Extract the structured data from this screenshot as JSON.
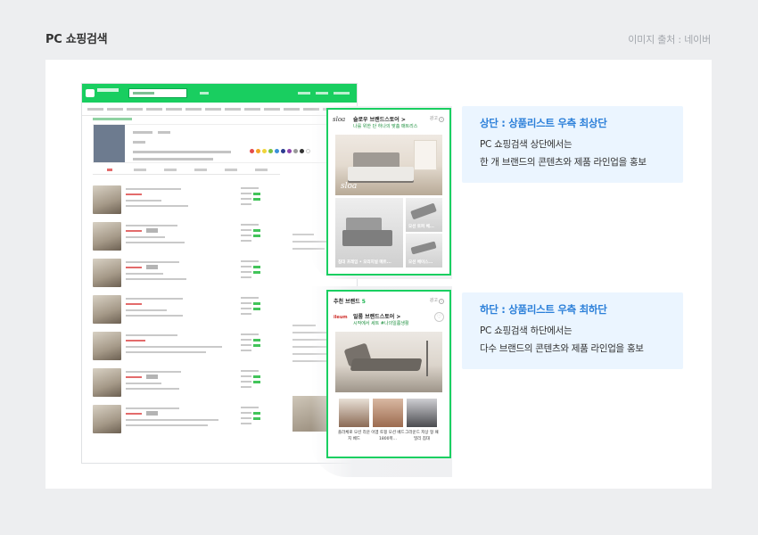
{
  "header": {
    "title": "PC 쇼핑검색",
    "source": "이미지 출처 : 네이버"
  },
  "callout_top": {
    "logo": "sloa",
    "brand_name": "슬로우 브랜드스토어 >",
    "brand_sub": "나를 위한 단 하나의 맞춤 매트리스",
    "ad_label": "광고",
    "info_icon": "i",
    "hero_mark": "sloa",
    "tiles": [
      "침대 프레임 • 오리지널 매트...",
      "모션 토퍼 베...",
      "모션 베이스..."
    ]
  },
  "callout_bottom": {
    "title": "추천 브랜드",
    "count": "5",
    "ad_label": "광고",
    "info_icon": "i",
    "logo": "ileum",
    "brand_name": "일룸 브랜드스토어 >",
    "brand_sub": "시작에서 세트 #나의일룸생활",
    "products": [
      "플라체로 모션 라운지 베드",
      "이엠 토핑 모션 베드 1800폭...",
      "그라운드 저상 형 패밀리 침대"
    ]
  },
  "info_top": {
    "title": "상단 : 상품리스트 우측 최상단",
    "line1": "PC 쇼핑검색 상단에서는",
    "line2": "한 개 브랜드의 콘텐츠와 제품 라인업을 홍보"
  },
  "info_bottom": {
    "title": "하단 : 상품리스트 우측 최하단",
    "line1": "PC 쇼핑검색 하단에서는",
    "line2": "다수 브랜드의 콘텐츠와 제품 라인업을 홍보"
  },
  "colors": {
    "naver_green": "#19ce60",
    "highlight_border": "#19cf61",
    "info_title_blue": "#2b7fd9",
    "info_bg": "#ebf5ff"
  }
}
